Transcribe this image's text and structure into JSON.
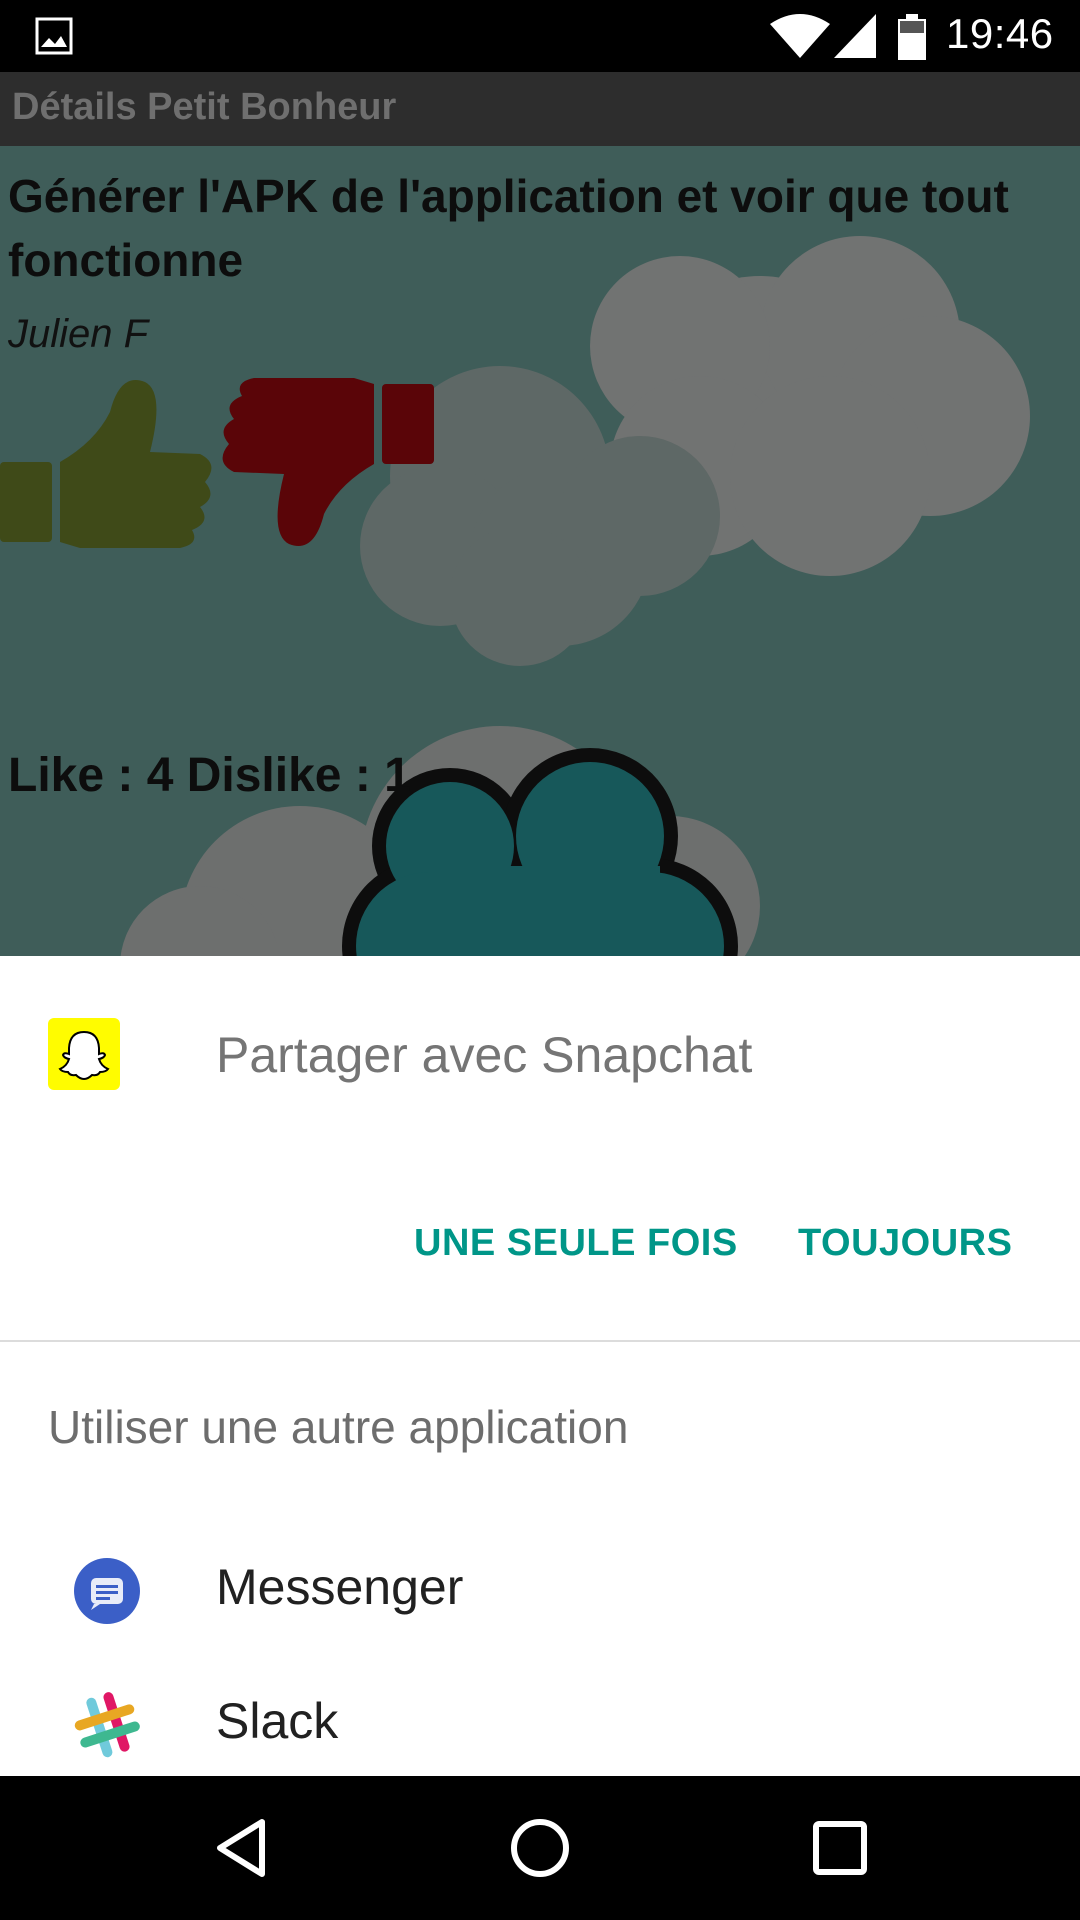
{
  "status_bar": {
    "time": "19:46",
    "left_icon": "image-icon",
    "icons": [
      "wifi-icon",
      "signal-icon",
      "battery-icon"
    ]
  },
  "app": {
    "toolbar_title": "Détails Petit Bonheur",
    "post_title": "Générer l'APK de l'application et voir que tout fonctionne",
    "author": "Julien F",
    "counts_text": "Like : 4 Dislike : 1",
    "like_icon": "thumbs-up-icon",
    "dislike_icon": "thumbs-down-icon"
  },
  "share_sheet": {
    "title": "Partager avec Snapchat",
    "title_icon": "snapchat-icon",
    "once_label": "UNE SEULE FOIS",
    "always_label": "TOUJOURS",
    "other_apps_heading": "Utiliser une autre application",
    "apps": [
      {
        "label": "Messenger",
        "icon": "messenger-icon"
      },
      {
        "label": "Slack",
        "icon": "slack-icon"
      }
    ],
    "accent_color": "#009688"
  },
  "nav_bar": {
    "buttons": [
      "back-icon",
      "home-icon",
      "recents-icon"
    ]
  }
}
